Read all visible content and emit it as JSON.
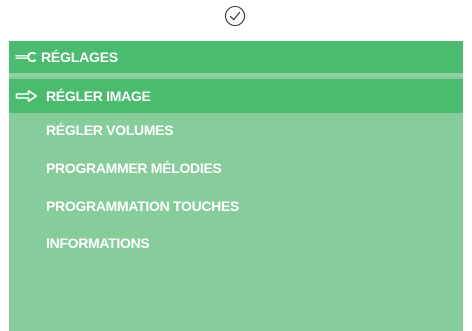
{
  "top_bar": {
    "icon": "check-circle-icon"
  },
  "header": {
    "icon": "wrench-icon",
    "title": "RÉGLAGES"
  },
  "menu": {
    "selected_index": 0,
    "selected_icon": "arrow-right-icon",
    "items": [
      {
        "label": "RÉGLER IMAGE"
      },
      {
        "label": "RÉGLER VOLUMES"
      },
      {
        "label": "PROGRAMMER MÉLODIES"
      },
      {
        "label": "PROGRAMMATION TOUCHES"
      },
      {
        "label": "INFORMATIONS"
      }
    ]
  },
  "colors": {
    "header_bg": "#4bbb6f",
    "panel_bg": "#86cd9b",
    "text": "#ffffff"
  }
}
